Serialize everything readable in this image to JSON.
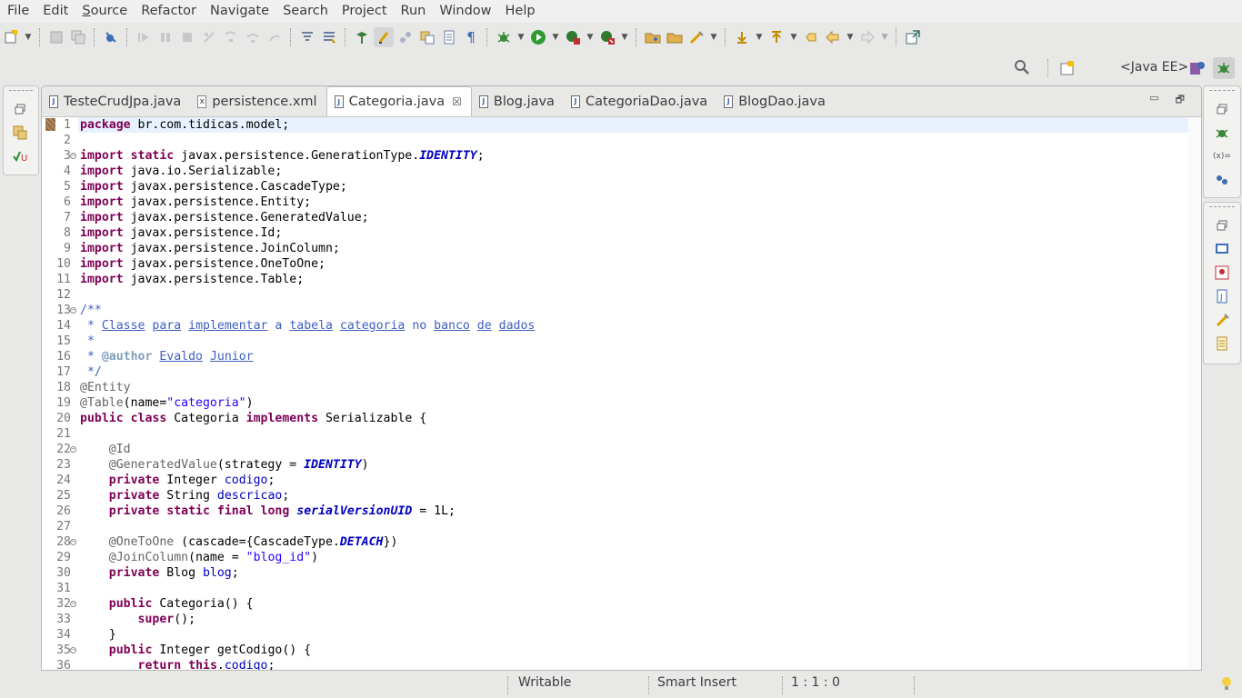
{
  "menu": [
    "File",
    "Edit",
    "Source",
    "Refactor",
    "Navigate",
    "Search",
    "Project",
    "Run",
    "Window",
    "Help"
  ],
  "toolbar": {
    "icons": [
      "new-wizard-icon",
      "save-icon",
      "save-all-icon",
      "skip-breakpoints-icon",
      "resume-icon",
      "suspend-icon",
      "terminate-icon",
      "disconnect-icon",
      "step-into-icon",
      "step-over-icon",
      "step-return-icon",
      "use-step-filters-icon",
      "toggle-mark-occurrences-icon",
      "new-java-package-icon",
      "highlight-icon",
      "toggle-breadcrumb-icon",
      "open-type-icon",
      "open-resource-icon",
      "toggle-block-selection-icon",
      "show-whitespace-icon",
      "debug-icon",
      "run-icon",
      "coverage-icon",
      "external-tools-icon",
      "open-folder-icon",
      "open-task-icon",
      "search-tools-icon",
      "next-annotation-icon",
      "previous-annotation-icon",
      "last-edit-icon",
      "back-icon",
      "forward-icon",
      "open-perspective-icon"
    ]
  },
  "perspective": {
    "label": "<Java EE>"
  },
  "tabs": [
    {
      "label": "TesteCrudJpa.java",
      "icon": "java-file-icon",
      "active": false
    },
    {
      "label": "persistence.xml",
      "icon": "xml-file-icon",
      "active": false
    },
    {
      "label": "Categoria.java",
      "icon": "java-file-icon",
      "active": true
    },
    {
      "label": "Blog.java",
      "icon": "java-file-icon",
      "active": false
    },
    {
      "label": "CategoriaDao.java",
      "icon": "java-file-icon",
      "active": false
    },
    {
      "label": "BlogDao.java",
      "icon": "java-file-icon",
      "active": false
    }
  ],
  "editor": {
    "lines": [
      {
        "n": "1",
        "fold": false,
        "html": "<span class=\"kw\">package</span> br.com.tidicas.model;"
      },
      {
        "n": "2",
        "fold": false,
        "html": ""
      },
      {
        "n": "3",
        "fold": true,
        "html": "<span class=\"kw\">import</span> <span class=\"kw\">static</span> javax.persistence.GenerationType.<span class=\"st\">IDENTITY</span>;"
      },
      {
        "n": "4",
        "fold": false,
        "html": "<span class=\"kw\">import</span> java.io.Serializable;"
      },
      {
        "n": "5",
        "fold": false,
        "html": "<span class=\"kw\">import</span> javax.persistence.CascadeType;"
      },
      {
        "n": "6",
        "fold": false,
        "html": "<span class=\"kw\">import</span> javax.persistence.Entity;"
      },
      {
        "n": "7",
        "fold": false,
        "html": "<span class=\"kw\">import</span> javax.persistence.GeneratedValue;"
      },
      {
        "n": "8",
        "fold": false,
        "html": "<span class=\"kw\">import</span> javax.persistence.Id;"
      },
      {
        "n": "9",
        "fold": false,
        "html": "<span class=\"kw\">import</span> javax.persistence.JoinColumn;"
      },
      {
        "n": "10",
        "fold": false,
        "html": "<span class=\"kw\">import</span> javax.persistence.OneToOne;"
      },
      {
        "n": "11",
        "fold": false,
        "html": "<span class=\"kw\">import</span> javax.persistence.Table;"
      },
      {
        "n": "12",
        "fold": false,
        "html": ""
      },
      {
        "n": "13",
        "fold": true,
        "html": "<span class=\"cm\">/**</span>"
      },
      {
        "n": "14",
        "fold": false,
        "html": "<span class=\"cm\"> * <span class=\"cm-u\">Classe</span> <span class=\"cm-u\">para</span> <span class=\"cm-u\">implementar</span> a <span class=\"cm-u\">tabela</span> <span class=\"cm-u\">categoria</span> no <span class=\"cm-u\">banco</span> <span class=\"cm-u\">de</span> <span class=\"cm-u\">dados</span></span>"
      },
      {
        "n": "15",
        "fold": false,
        "html": "<span class=\"cm\"> *</span>"
      },
      {
        "n": "16",
        "fold": false,
        "html": "<span class=\"cm\"> * <span class=\"tag\">@author</span> <span class=\"cm-u\">Evaldo</span> <span class=\"cm-u\">Junior</span></span>"
      },
      {
        "n": "17",
        "fold": false,
        "html": "<span class=\"cm\"> */</span>"
      },
      {
        "n": "18",
        "fold": false,
        "html": "<span class=\"an\">@Entity</span>"
      },
      {
        "n": "19",
        "fold": false,
        "html": "<span class=\"an\">@Table</span>(name=<span class=\"str\">\"categoria\"</span>)"
      },
      {
        "n": "20",
        "fold": false,
        "html": "<span class=\"kw\">public</span> <span class=\"kw\">class</span> Categoria <span class=\"kw\">implements</span> Serializable {"
      },
      {
        "n": "21",
        "fold": false,
        "html": ""
      },
      {
        "n": "22",
        "fold": true,
        "html": "    <span class=\"an\">@Id</span>"
      },
      {
        "n": "23",
        "fold": false,
        "html": "    <span class=\"an\">@GeneratedValue</span>(strategy = <span class=\"st\">IDENTITY</span>)"
      },
      {
        "n": "24",
        "fold": false,
        "html": "    <span class=\"kw\">private</span> Integer <span class=\"fld\">codigo</span>;"
      },
      {
        "n": "25",
        "fold": false,
        "html": "    <span class=\"kw\">private</span> String <span class=\"fld\">descricao</span>;"
      },
      {
        "n": "26",
        "fold": false,
        "html": "    <span class=\"kw\">private</span> <span class=\"kw\">static</span> <span class=\"kw\">final</span> <span class=\"kw\">long</span> <span class=\"st\">serialVersionUID</span> = 1L;"
      },
      {
        "n": "27",
        "fold": false,
        "html": ""
      },
      {
        "n": "28",
        "fold": true,
        "html": "    <span class=\"an\">@OneToOne</span> (cascade={CascadeType.<span class=\"st\">DETACH</span>})"
      },
      {
        "n": "29",
        "fold": false,
        "html": "    <span class=\"an\">@JoinColumn</span>(name = <span class=\"str\">\"blog_id\"</span>)"
      },
      {
        "n": "30",
        "fold": false,
        "html": "    <span class=\"kw\">private</span> Blog <span class=\"fld\">blog</span>;"
      },
      {
        "n": "31",
        "fold": false,
        "html": ""
      },
      {
        "n": "32",
        "fold": true,
        "html": "    <span class=\"kw\">public</span> Categoria() {"
      },
      {
        "n": "33",
        "fold": false,
        "html": "        <span class=\"kw\">super</span>();"
      },
      {
        "n": "34",
        "fold": false,
        "html": "    }"
      },
      {
        "n": "35",
        "fold": true,
        "html": "    <span class=\"kw\">public</span> Integer getCodigo() {"
      },
      {
        "n": "36",
        "fold": false,
        "html": "        <span class=\"kw\">return</span> <span class=\"kw\">this</span>.<span class=\"fld\">codigo</span>;"
      }
    ]
  },
  "status": {
    "writable": "Writable",
    "insert_mode": "Smart Insert",
    "position": "1 : 1 : 0"
  }
}
